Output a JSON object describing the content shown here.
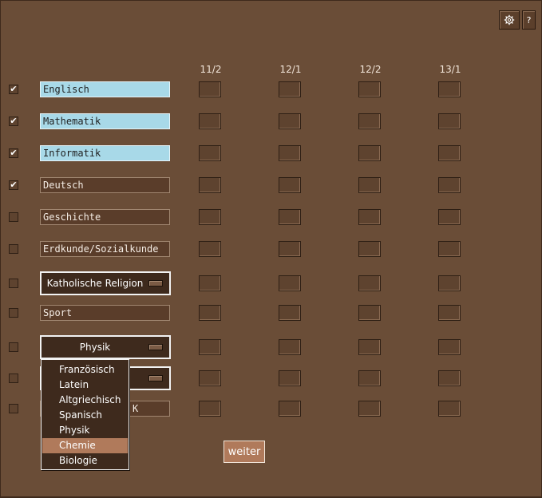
{
  "toolbar": {
    "settings_icon": "gear-icon",
    "help_label": "?"
  },
  "columns": [
    "11/2",
    "12/1",
    "12/2",
    "13/1"
  ],
  "rows": [
    {
      "checked": true,
      "label": "Englisch",
      "type": "field",
      "active": true
    },
    {
      "checked": true,
      "label": "Mathematik",
      "type": "field",
      "active": true
    },
    {
      "checked": true,
      "label": "Informatik",
      "type": "field",
      "active": true
    },
    {
      "checked": true,
      "label": "Deutsch",
      "type": "field",
      "active": false
    },
    {
      "checked": false,
      "label": "Geschichte",
      "type": "field",
      "active": false
    },
    {
      "checked": false,
      "label": "Erdkunde/Sozialkunde",
      "type": "field",
      "active": false
    },
    {
      "checked": false,
      "label": "Katholische Religion",
      "type": "combo"
    },
    {
      "checked": false,
      "label": "Sport",
      "type": "field",
      "active": false
    },
    {
      "checked": false,
      "label": "Physik",
      "type": "combo"
    },
    {
      "checked": false,
      "label": "",
      "type": "combo"
    },
    {
      "checked": false,
      "label": "K",
      "type": "field",
      "active": false
    }
  ],
  "dropdown": {
    "options": [
      "Französisch",
      "Latein",
      "Altgriechisch",
      "Spanisch",
      "Physik",
      "Chemie",
      "Biologie"
    ],
    "selected_index": 5
  },
  "weiter_label": "weiter",
  "check_mark": "✔",
  "colors": {
    "background": "#6a4d37",
    "active_field": "#a8d9e8",
    "highlight": "#b07a5b"
  }
}
